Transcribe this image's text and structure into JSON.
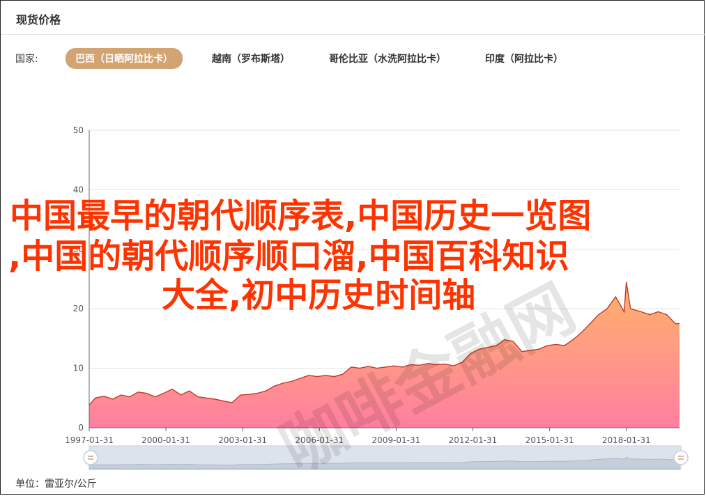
{
  "header": {
    "title": "现货价格"
  },
  "country_filter": {
    "label": "国家:",
    "options": [
      {
        "label": "巴西（日晒阿拉比卡）",
        "active": true
      },
      {
        "label": "越南（罗布斯塔）",
        "active": false
      },
      {
        "label": "哥伦比亚（水洗阿拉比卡）",
        "active": false
      },
      {
        "label": "印度（阿拉比卡）",
        "active": false
      }
    ]
  },
  "unit_text": "单位：雷亚尔/公斤",
  "overlay_text": {
    "line1": "中国最早的朝代顺序表,中国历史一览图",
    "line2": ",中国的朝代顺序顺口溜,中国百科知识",
    "line3": "大全,初中历史时间轴",
    "stamp": "咖啡金融网"
  },
  "colors": {
    "accent": "#d2a472",
    "area_top": "#ffa96b",
    "area_bottom": "#ff7f9c",
    "line": "#c0392b",
    "overlay": "#ff3300"
  },
  "chart_data": {
    "type": "area",
    "title": "",
    "xlabel": "",
    "ylabel": "",
    "ylim": [
      0,
      50
    ],
    "yticks": [
      0,
      10,
      20,
      30,
      40,
      50
    ],
    "xlim": [
      "1997-01-31",
      "2020-02-29"
    ],
    "xticks": [
      "1997-01-31",
      "2000-01-31",
      "2003-01-31",
      "2006-01-31",
      "2009-01-31",
      "2012-01-31",
      "2015-01-31",
      "2018-01-31"
    ],
    "grid": true,
    "series": [
      {
        "values": [
          [
            "1997-01-31",
            3.8
          ],
          [
            "1997-04-30",
            5.0
          ],
          [
            "1997-08-31",
            5.3
          ],
          [
            "1997-12-31",
            4.8
          ],
          [
            "1998-04-30",
            5.5
          ],
          [
            "1998-08-31",
            5.2
          ],
          [
            "1998-12-31",
            6.0
          ],
          [
            "1999-04-30",
            5.8
          ],
          [
            "1999-08-31",
            5.2
          ],
          [
            "1999-12-31",
            5.8
          ],
          [
            "2000-04-30",
            6.5
          ],
          [
            "2000-08-31",
            5.5
          ],
          [
            "2000-12-31",
            6.2
          ],
          [
            "2001-04-30",
            5.2
          ],
          [
            "2001-08-31",
            5.0
          ],
          [
            "2001-12-31",
            4.8
          ],
          [
            "2002-04-30",
            4.5
          ],
          [
            "2002-08-31",
            4.2
          ],
          [
            "2002-12-31",
            5.5
          ],
          [
            "2003-04-30",
            5.6
          ],
          [
            "2003-08-31",
            5.8
          ],
          [
            "2003-12-31",
            6.2
          ],
          [
            "2004-04-30",
            7.0
          ],
          [
            "2004-08-31",
            7.5
          ],
          [
            "2004-12-31",
            7.8
          ],
          [
            "2005-04-30",
            8.3
          ],
          [
            "2005-08-31",
            8.8
          ],
          [
            "2005-12-31",
            8.6
          ],
          [
            "2006-04-30",
            8.8
          ],
          [
            "2006-08-31",
            8.6
          ],
          [
            "2006-12-31",
            9.0
          ],
          [
            "2007-04-30",
            10.2
          ],
          [
            "2007-08-31",
            10.0
          ],
          [
            "2007-12-31",
            10.3
          ],
          [
            "2008-04-30",
            10.0
          ],
          [
            "2008-08-31",
            10.2
          ],
          [
            "2008-12-31",
            10.4
          ],
          [
            "2009-04-30",
            10.2
          ],
          [
            "2009-08-31",
            10.6
          ],
          [
            "2009-12-31",
            10.5
          ],
          [
            "2010-04-30",
            10.8
          ],
          [
            "2010-08-31",
            10.6
          ],
          [
            "2010-12-31",
            10.7
          ],
          [
            "2011-04-30",
            10.4
          ],
          [
            "2011-08-31",
            11.0
          ],
          [
            "2011-12-31",
            12.5
          ],
          [
            "2012-04-30",
            13.2
          ],
          [
            "2012-08-31",
            13.5
          ],
          [
            "2012-12-31",
            13.8
          ],
          [
            "2013-04-30",
            14.8
          ],
          [
            "2013-08-31",
            14.5
          ],
          [
            "2013-12-31",
            12.8
          ],
          [
            "2014-04-30",
            13.0
          ],
          [
            "2014-08-31",
            13.2
          ],
          [
            "2014-12-31",
            13.8
          ],
          [
            "2015-04-30",
            14.0
          ],
          [
            "2015-08-31",
            13.8
          ],
          [
            "2015-12-31",
            14.8
          ],
          [
            "2016-04-30",
            16.0
          ],
          [
            "2016-08-31",
            17.5
          ],
          [
            "2016-12-31",
            19.0
          ],
          [
            "2017-04-30",
            20.0
          ],
          [
            "2017-08-31",
            22.0
          ],
          [
            "2017-12-31",
            19.5
          ],
          [
            "2018-01-31",
            24.5
          ],
          [
            "2018-03-31",
            20.0
          ],
          [
            "2018-08-31",
            19.5
          ],
          [
            "2018-12-31",
            19.0
          ],
          [
            "2019-04-30",
            19.5
          ],
          [
            "2019-08-31",
            19.0
          ],
          [
            "2019-12-31",
            17.5
          ],
          [
            "2020-02-29",
            17.5
          ]
        ]
      }
    ]
  }
}
